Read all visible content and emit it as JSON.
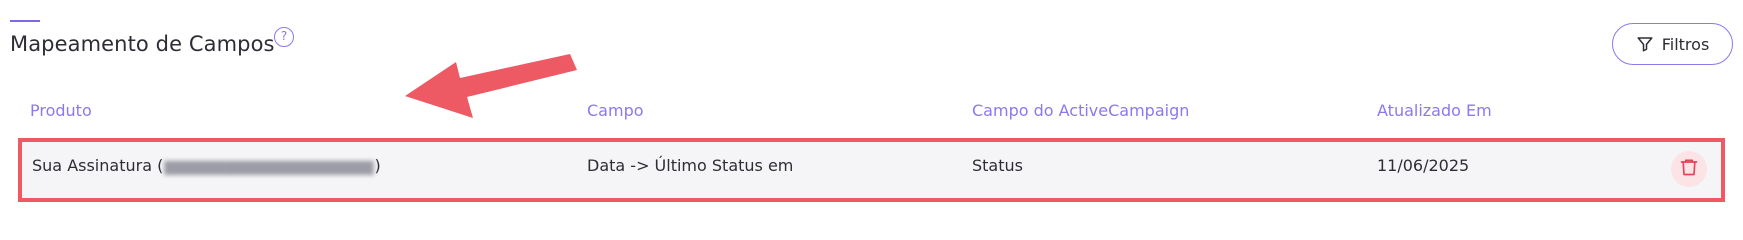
{
  "header": {
    "title": "Mapeamento de Campos",
    "help_icon": "question-circle-icon",
    "help_glyph": "?",
    "filter_label": "Filtros",
    "filter_icon": "filter-icon"
  },
  "table": {
    "columns": [
      "Produto",
      "Campo",
      "Campo do ActiveCampaign",
      "Atualizado Em"
    ],
    "rows": [
      {
        "produto_prefix": "Sua Assinatura (",
        "produto_redacted": "Redacted identifier",
        "produto_suffix": ")",
        "campo": "Data -> Último Status em",
        "campo_activecampaign": "Status",
        "atualizado_em": "11/06/2025",
        "action_icon": "trash-icon"
      }
    ]
  },
  "annotation": {
    "arrow_color": "#ee5a64",
    "highlight_color": "#ee5a64"
  },
  "colors": {
    "accent": "#8a79ef",
    "danger": "#e0455a",
    "row_bg": "#f5f5f7"
  }
}
